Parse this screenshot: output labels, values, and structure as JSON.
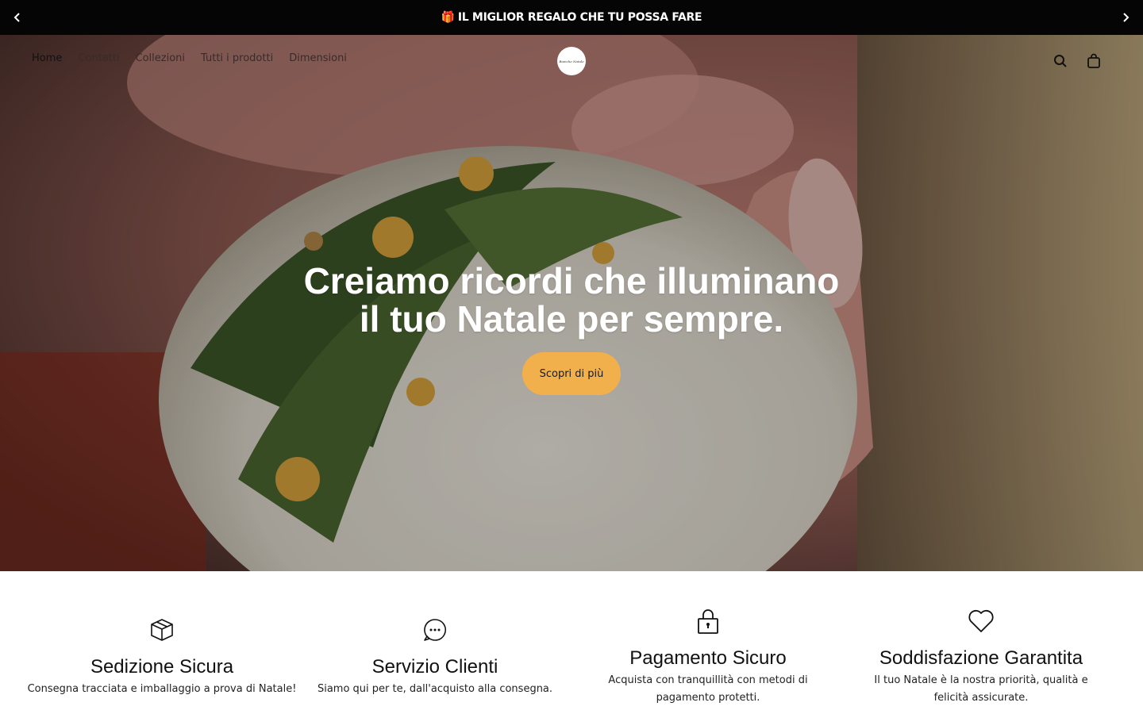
{
  "announcement": {
    "gift_icon": "gift-icon",
    "text": "IL MIGLIOR REGALO CHE TU POSSA FARE",
    "prev_icon": "chevron-left-icon",
    "next_icon": "chevron-right-icon"
  },
  "nav": {
    "items": [
      {
        "label": "Home"
      },
      {
        "label": "Contatti"
      },
      {
        "label": "Collezioni"
      },
      {
        "label": "Tutti i prodotti"
      },
      {
        "label": "Dimensioni"
      }
    ],
    "logo_text": "Bianche Natale",
    "search_icon": "search-icon",
    "cart_icon": "shopping-bag-icon"
  },
  "hero": {
    "title_line1": "Creiamo ricordi che illuminano",
    "title_line2": "il tuo Natale per sempre.",
    "cta_label": "Scopri di più"
  },
  "features": [
    {
      "icon": "box-icon",
      "title": "Sedizione Sicura",
      "text_line1": "Consegna tracciata e imballaggio a prova di Natale!",
      "text_line2": ""
    },
    {
      "icon": "chat-bubble-icon",
      "title": "Servizio Clienti",
      "text_line1": "Siamo qui per te, dall'acquisto alla consegna.",
      "text_line2": ""
    },
    {
      "icon": "lock-icon",
      "title": "Pagamento Sicuro",
      "text_line1": "Acquista con tranquillità con metodi di",
      "text_line2": "pagamento protetti."
    },
    {
      "icon": "heart-icon",
      "title": "Soddisfazione Garantita",
      "text_line1": "Il tuo Natale è la nostra priorità, qualità e",
      "text_line2": "felicità assicurate."
    }
  ],
  "colors": {
    "accent": "#f2b04c",
    "announcement_bg": "#050505"
  }
}
